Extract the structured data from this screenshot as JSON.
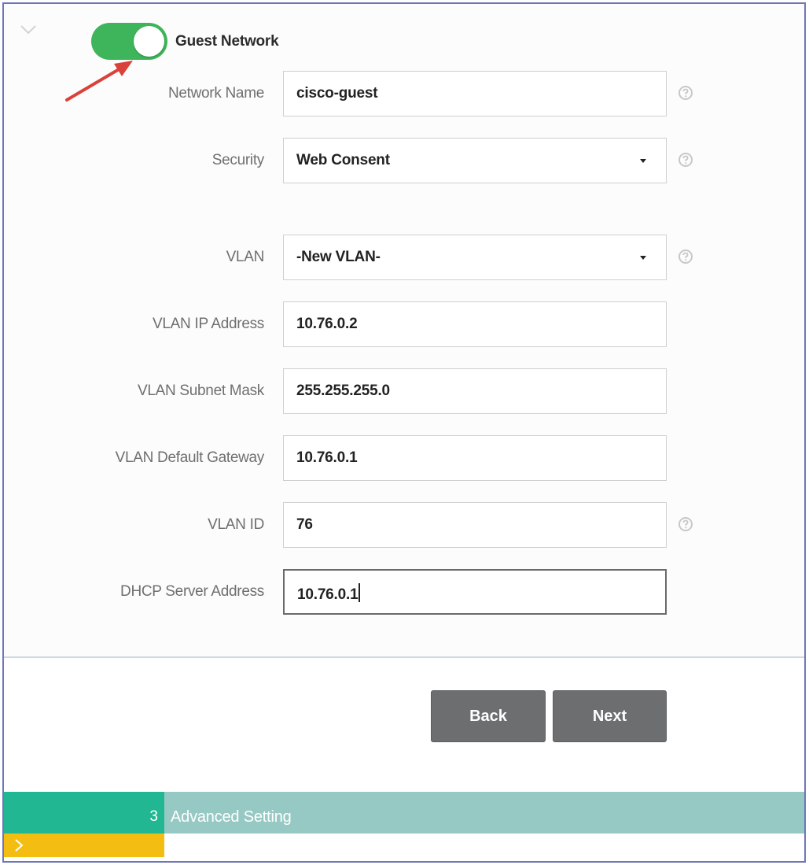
{
  "header": {
    "toggle_state": "on",
    "toggle_label": "Guest Network"
  },
  "form": {
    "network_name": {
      "label": "Network Name",
      "value": "cisco-guest",
      "help": "help-icon"
    },
    "security": {
      "label": "Security",
      "value": "Web Consent",
      "help": "help-icon"
    },
    "vlan": {
      "label": "VLAN",
      "value": "-New VLAN-",
      "help": "help-icon"
    },
    "vlan_ip": {
      "label": "VLAN IP Address",
      "value": "10.76.0.2"
    },
    "vlan_subnet": {
      "label": "VLAN Subnet Mask",
      "value": "255.255.255.0"
    },
    "vlan_gateway": {
      "label": "VLAN Default Gateway",
      "value": "10.76.0.1"
    },
    "vlan_id": {
      "label": "VLAN ID",
      "value": "76",
      "help": "help-icon"
    },
    "dhcp_server": {
      "label": "DHCP Server Address",
      "value": "10.76.0.1"
    }
  },
  "actions": {
    "back_label": "Back",
    "next_label": "Next"
  },
  "step": {
    "number": "3",
    "title": "Advanced Setting"
  },
  "colors": {
    "toggle_on": "#3eb55b",
    "button": "#6c6e70",
    "step_number_bg": "#22b793",
    "step_bar_bg": "#97c9c4",
    "step_under_bg": "#f3bd11",
    "annotation_arrow": "#d9423a"
  }
}
